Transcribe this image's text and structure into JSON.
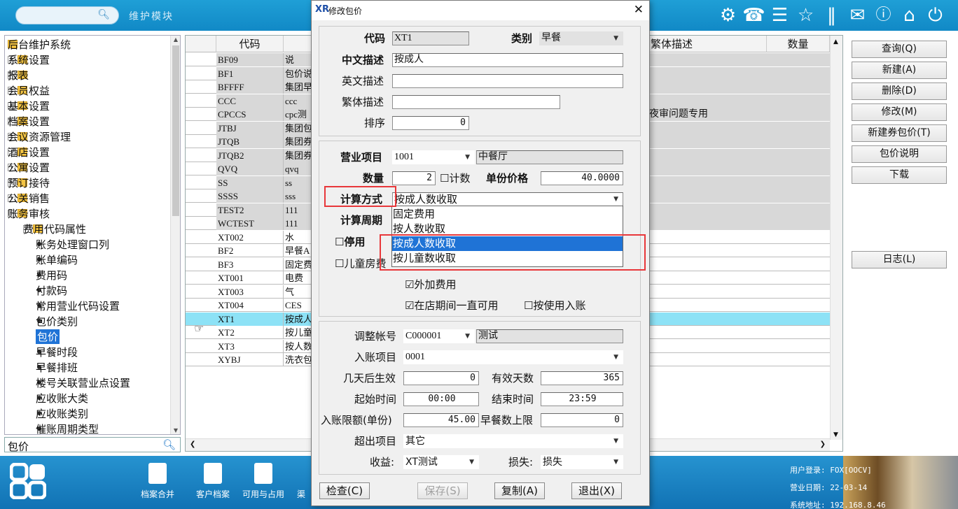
{
  "topbar": {
    "search_icon": "search-icon",
    "module_title": "维护模块",
    "icons": [
      "gear-icon",
      "phone-icon",
      "menu-icon",
      "star-icon",
      "columns-icon",
      "mail-icon",
      "help-icon",
      "home-icon",
      "power-icon"
    ]
  },
  "tree": {
    "items": [
      {
        "label": "后台维护系统",
        "kind": "folder",
        "level": 0
      },
      {
        "label": "系统设置",
        "kind": "folder",
        "level": 1
      },
      {
        "label": "报表",
        "kind": "folder",
        "level": 1
      },
      {
        "label": "会员权益",
        "kind": "folder",
        "level": 1
      },
      {
        "label": "基本设置",
        "kind": "folder",
        "level": 1
      },
      {
        "label": "档案设置",
        "kind": "folder",
        "level": 1
      },
      {
        "label": "会议资源管理",
        "kind": "folder",
        "level": 1
      },
      {
        "label": "酒店设置",
        "kind": "folder",
        "level": 1
      },
      {
        "label": "公寓设置",
        "kind": "folder",
        "level": 1
      },
      {
        "label": "预订接待",
        "kind": "folder",
        "level": 1
      },
      {
        "label": "公关销售",
        "kind": "folder",
        "level": 1
      },
      {
        "label": "账务审核",
        "kind": "folder-open",
        "level": 1
      },
      {
        "label": "费用代码属性",
        "kind": "folder",
        "level": 2
      },
      {
        "label": "账务处理窗口列",
        "kind": "leaf",
        "level": 2
      },
      {
        "label": "账单编码",
        "kind": "leaf",
        "level": 2
      },
      {
        "label": "费用码",
        "kind": "leaf",
        "level": 2
      },
      {
        "label": "付款码",
        "kind": "leaf",
        "level": 2
      },
      {
        "label": "常用营业代码设置",
        "kind": "leaf",
        "level": 2
      },
      {
        "label": "包价类别",
        "kind": "leaf",
        "level": 2
      },
      {
        "label": "包价",
        "kind": "leaf",
        "level": 2,
        "selected": true
      },
      {
        "label": "早餐时段",
        "kind": "leaf",
        "level": 2
      },
      {
        "label": "早餐排班",
        "kind": "leaf",
        "level": 2
      },
      {
        "label": "楼号关联营业点设置",
        "kind": "leaf",
        "level": 2
      },
      {
        "label": "应收账大类",
        "kind": "leaf",
        "level": 2
      },
      {
        "label": "应收账类别",
        "kind": "leaf",
        "level": 2
      },
      {
        "label": "催账周期类型",
        "kind": "leaf",
        "level": 2
      }
    ],
    "search_value": "包价"
  },
  "grid": {
    "headers": {
      "code": "代码",
      "trad_desc": "繁体描述",
      "qty": "数量"
    },
    "rows": [
      {
        "code": "BF09",
        "desc": "说",
        "gray": true
      },
      {
        "code": "BF1",
        "desc": "包价说",
        "gray": true
      },
      {
        "code": "BFFFF",
        "desc": "集团早",
        "gray": true
      },
      {
        "code": "CCC",
        "desc": "ccc",
        "gray": true
      },
      {
        "code": "CPCCS",
        "desc": "cpc测",
        "gray": true,
        "trad": "夜审问题专用"
      },
      {
        "code": "JTBJ",
        "desc": "集团包",
        "gray": true
      },
      {
        "code": "JTQB",
        "desc": "集团券",
        "gray": true
      },
      {
        "code": "JTQB2",
        "desc": "集团券",
        "gray": true
      },
      {
        "code": "QVQ",
        "desc": "qvq",
        "gray": true
      },
      {
        "code": "SS",
        "desc": "ss",
        "gray": true
      },
      {
        "code": "SSSS",
        "desc": "sss",
        "gray": true
      },
      {
        "code": "TEST2",
        "desc": "111",
        "gray": true
      },
      {
        "code": "WCTEST",
        "desc": "111",
        "gray": true
      },
      {
        "code": "XT002",
        "desc": "水",
        "gray": false
      },
      {
        "code": "BF2",
        "desc": "早餐A",
        "gray": false
      },
      {
        "code": "BF3",
        "desc": "固定费",
        "gray": false
      },
      {
        "code": "XT001",
        "desc": "电费",
        "gray": false
      },
      {
        "code": "XT003",
        "desc": "气",
        "gray": false
      },
      {
        "code": "XT004",
        "desc": "CES",
        "gray": false
      },
      {
        "code": "XT1",
        "desc": "按成人",
        "gray": false,
        "selected": true
      },
      {
        "code": "XT2",
        "desc": "按儿童",
        "gray": false
      },
      {
        "code": "XT3",
        "desc": "按人数",
        "gray": false
      },
      {
        "code": "XYBJ",
        "desc": "洗衣包",
        "gray": false
      }
    ]
  },
  "right_buttons": {
    "query": "查询(Q)",
    "new": "新建(A)",
    "delete": "删除(D)",
    "modify": "修改(M)",
    "new_coupon": "新建券包价(T)",
    "package_desc": "包价说明",
    "download": "下载",
    "log": "日志(L)"
  },
  "dialog": {
    "title": "修改包价",
    "logo": "XR",
    "code_label": "代码",
    "code": "XT1",
    "category_label": "类别",
    "category": "早餐",
    "cn_desc_label": "中文描述",
    "cn_desc": "按成人",
    "en_desc_label": "英文描述",
    "en_desc": "",
    "tw_desc_label": "繁体描述",
    "tw_desc": "",
    "sort_label": "排序",
    "sort": "0",
    "biz_item_label": "营业项目",
    "biz_item": "1001",
    "biz_item_name": "中餐厅",
    "qty_label": "数量",
    "qty": "2",
    "count_label": "计数",
    "unit_price_label": "单份价格",
    "unit_price": "40.0000",
    "calc_mode_label": "计算方式",
    "calc_mode": "按成人数收取",
    "calc_period_label": "计算周期",
    "disabled_label": "停用",
    "child_room_label": "儿童房费",
    "calc_options": [
      "固定费用",
      "按人数收取",
      "按成人数收取",
      "按儿童数收取"
    ],
    "extra_fee_label": "外加费用",
    "always_label": "在店期间一直可用",
    "by_use_label": "按使用入账",
    "adj_account_label": "调整帐号",
    "adj_account": "C000001",
    "adj_account_name": "测试",
    "post_item_label": "入账项目",
    "post_item": "0001",
    "days_effect_label": "几天后生效",
    "days_effect": "0",
    "valid_days_label": "有效天数",
    "valid_days": "365",
    "start_time_label": "起始时间",
    "start_time": "00:00",
    "end_time_label": "结束时间",
    "end_time": "23:59",
    "post_limit_label": "入账限额(单份)",
    "post_limit": "45.00",
    "bf_limit_label": "早餐数上限",
    "bf_limit": "0",
    "overflow_label": "超出项目",
    "overflow": "其它",
    "income_label": "收益:",
    "income": "XT测试",
    "loss_label": "损失:",
    "loss": "损失",
    "btn_check": "检查(C)",
    "btn_save": "保存(S)",
    "btn_copy": "复制(A)",
    "btn_exit": "退出(X)"
  },
  "bottombar": {
    "tools": [
      "档案合并",
      "客户档案",
      "可用与占用",
      "渠"
    ],
    "login_label": "用户登录:",
    "login": "FOX[OOCV]",
    "bizdate_label": "营业日期:",
    "bizdate": "22-03-14",
    "addr_label": "系统地址:",
    "addr": "192.168.8.46"
  },
  "colors": {
    "accent": "#1f73d6",
    "highlight_row": "#8de2f6",
    "red_box": "#e8373a",
    "topbar": "#1189c6"
  }
}
